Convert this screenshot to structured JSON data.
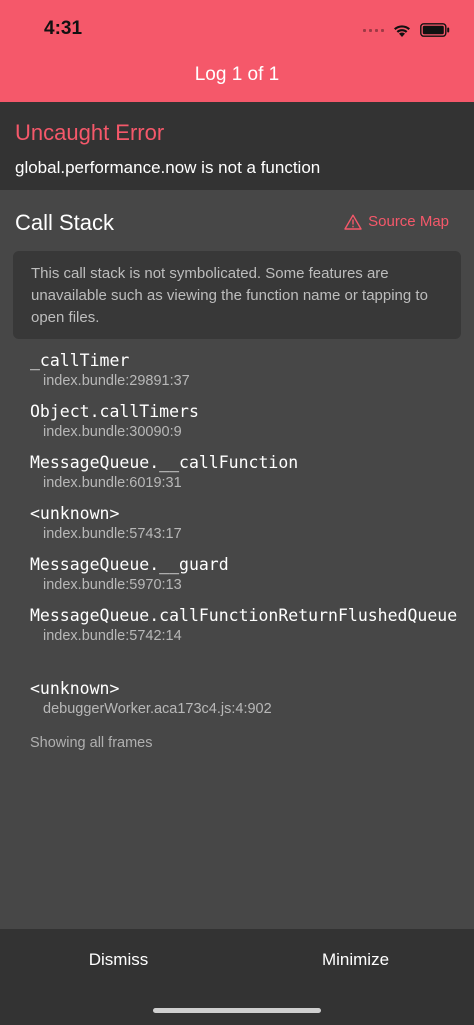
{
  "status_bar": {
    "time": "4:31"
  },
  "header": {
    "title": "Log 1 of 1"
  },
  "error": {
    "title": "Uncaught Error",
    "message": "global.performance.now is not a function"
  },
  "call_stack": {
    "title": "Call Stack",
    "source_map_label": "Source Map",
    "notice": "This call stack is not symbolicated. Some features are unavailable such as viewing the function name or tapping to open files.",
    "frames": [
      {
        "name": "_callTimer",
        "location": "index.bundle:29891:37"
      },
      {
        "name": "Object.callTimers",
        "location": "index.bundle:30090:9"
      },
      {
        "name": "MessageQueue.__callFunction",
        "location": "index.bundle:6019:31"
      },
      {
        "name": "<unknown>",
        "location": "index.bundle:5743:17"
      },
      {
        "name": "MessageQueue.__guard",
        "location": "index.bundle:5970:13"
      },
      {
        "name": "MessageQueue.callFunctionReturnFlushedQueue",
        "location": "index.bundle:5742:14"
      },
      {
        "name": "<unknown>",
        "location": "debuggerWorker.aca173c4.js:4:902"
      }
    ],
    "show_frames_label": "Showing all frames"
  },
  "footer": {
    "dismiss_label": "Dismiss",
    "minimize_label": "Minimize"
  },
  "colors": {
    "accent": "#f5586a",
    "background": "#474747",
    "panel": "#333333"
  }
}
